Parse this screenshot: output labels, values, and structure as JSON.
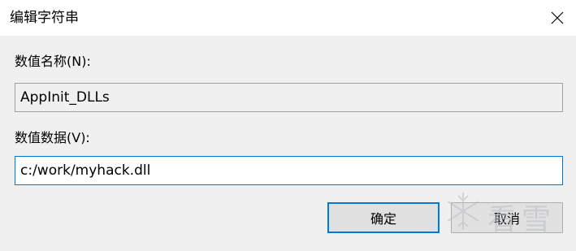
{
  "window": {
    "title": "编辑字符串",
    "close_icon": "close-icon"
  },
  "form": {
    "name_label": "数值名称(N):",
    "name_value": "AppInit_DLLs",
    "data_label": "数值数据(V):",
    "data_value": "c:/work/myhack.dll"
  },
  "buttons": {
    "ok_label": "确定",
    "cancel_label": "取消"
  },
  "watermark": {
    "text": "看雪",
    "icon": "snowflake-icon"
  },
  "colors": {
    "accent": "#0078d7",
    "client_background": "#f0f0f0"
  }
}
